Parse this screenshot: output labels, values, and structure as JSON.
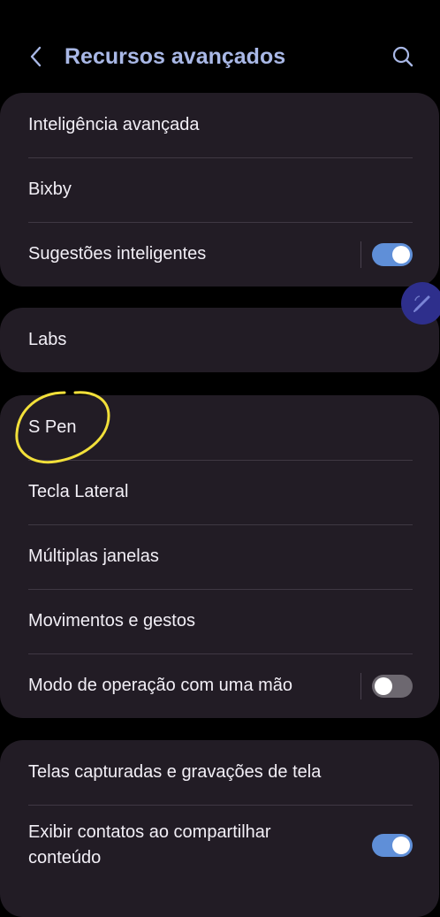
{
  "header": {
    "title": "Recursos avançados"
  },
  "card1": {
    "items": [
      {
        "label": "Inteligência avançada"
      },
      {
        "label": "Bixby"
      },
      {
        "label": "Sugestões inteligentes",
        "toggle": true
      }
    ]
  },
  "card2": {
    "items": [
      {
        "label": "Labs"
      }
    ]
  },
  "card3": {
    "items": [
      {
        "label": "S Pen"
      },
      {
        "label": "Tecla Lateral"
      },
      {
        "label": "Múltiplas janelas"
      },
      {
        "label": "Movimentos e gestos"
      },
      {
        "label": "Modo de operação com uma mão",
        "toggle": false
      }
    ]
  },
  "card4": {
    "items": [
      {
        "label": "Telas capturadas e gravações de tela"
      },
      {
        "label": "Exibir contatos ao compartilhar conteúdo",
        "toggle": true
      }
    ]
  },
  "colors": {
    "title": "#a9b8e6",
    "card_bg": "#221c25",
    "toggle_on": "#5f8fd8",
    "toggle_off": "#6d6870",
    "annotation": "#f2e03a"
  },
  "icons": {
    "back": "chevron-left-icon",
    "search": "search-icon",
    "pen": "pen-icon"
  }
}
